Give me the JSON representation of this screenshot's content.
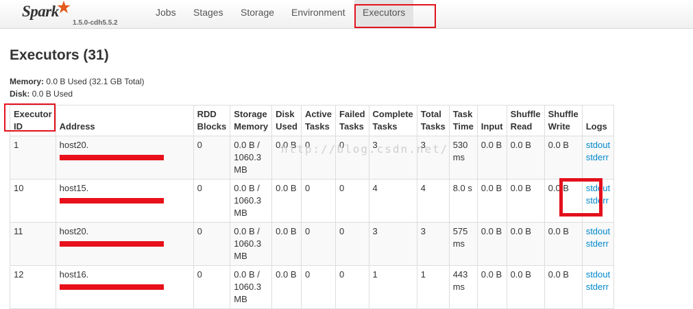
{
  "brand": {
    "name": "Spark",
    "version": "1.5.0-cdh5.5.2"
  },
  "nav": {
    "items": [
      "Jobs",
      "Stages",
      "Storage",
      "Environment",
      "Executors"
    ],
    "active": "Executors"
  },
  "page": {
    "title": "Executors (31)"
  },
  "summary": {
    "memory_label": "Memory:",
    "memory_value": "0.0 B Used (32.1 GB Total)",
    "disk_label": "Disk:",
    "disk_value": "0.0 B Used"
  },
  "table": {
    "headers": [
      "Executor ID",
      "Address",
      "RDD Blocks",
      "Storage Memory",
      "Disk Used",
      "Active Tasks",
      "Failed Tasks",
      "Complete Tasks",
      "Total Tasks",
      "Task Time",
      "Input",
      "Shuffle Read",
      "Shuffle Write",
      "Logs"
    ],
    "rows": [
      {
        "id": "1",
        "address": "host20.",
        "rdd": "0",
        "storage": "0.0 B / 1060.3 MB",
        "disk": "0.0 B",
        "active": "0",
        "failed": "0",
        "complete": "3",
        "total": "3",
        "time": "530 ms",
        "input": "0.0 B",
        "shuffle_read": "0.0 B",
        "shuffle_write": "0.0 B",
        "stdout": "stdout",
        "stderr": "stderr"
      },
      {
        "id": "10",
        "address": "host15.",
        "rdd": "0",
        "storage": "0.0 B / 1060.3 MB",
        "disk": "0.0 B",
        "active": "0",
        "failed": "0",
        "complete": "4",
        "total": "4",
        "time": "8.0 s",
        "input": "0.0 B",
        "shuffle_read": "0.0 B",
        "shuffle_write": "0.0 B",
        "stdout": "stdout",
        "stderr": "stderr"
      },
      {
        "id": "11",
        "address": "host20.",
        "rdd": "0",
        "storage": "0.0 B / 1060.3 MB",
        "disk": "0.0 B",
        "active": "0",
        "failed": "0",
        "complete": "3",
        "total": "3",
        "time": "575 ms",
        "input": "0.0 B",
        "shuffle_read": "0.0 B",
        "shuffle_write": "0.0 B",
        "stdout": "stdout",
        "stderr": "stderr"
      },
      {
        "id": "12",
        "address": "host16.",
        "rdd": "0",
        "storage": "0.0 B / 1060.3 MB",
        "disk": "0.0 B",
        "active": "0",
        "failed": "0",
        "complete": "1",
        "total": "1",
        "time": "443 ms",
        "input": "0.0 B",
        "shuffle_read": "0.0 B",
        "shuffle_write": "0.0 B",
        "stdout": "stdout",
        "stderr": "stderr"
      }
    ]
  },
  "watermark": "http://blog.csdn.net/",
  "colors": {
    "accent": "#e3101c",
    "link": "#0088cc",
    "logo_star": "#e25a1c"
  }
}
